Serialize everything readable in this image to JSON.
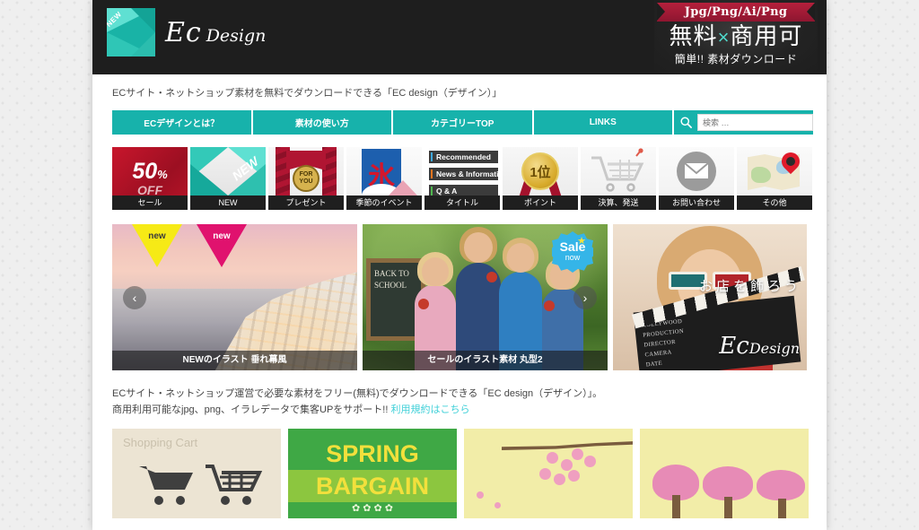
{
  "header": {
    "logo_ribbon": "NEW",
    "logo_text": "Ec",
    "logo_sub": "Design",
    "promo_ribbon": "Jpg/Png/Ai/Png",
    "promo_main_left": "無料",
    "promo_main_x": "×",
    "promo_main_right": "商用可",
    "promo_sub": "簡単!! 素材ダウンロード"
  },
  "tagline": "ECサイト・ネットショップ素材を無料でダウンロードできる「EC design（デザイン）」",
  "nav": {
    "items": [
      {
        "label": "ECデザインとは？"
      },
      {
        "label": "素材の使い方"
      },
      {
        "label": "カテゴリーTOP"
      },
      {
        "label": "LINKS"
      }
    ],
    "search_placeholder": "検索 …",
    "search_value": ""
  },
  "categories": [
    {
      "label": "セール",
      "art": "sale",
      "text_main": "50",
      "text_unit": "%",
      "text_sub": "OFF"
    },
    {
      "label": "NEW",
      "art": "new",
      "text_main": "NEW"
    },
    {
      "label": "プレゼント",
      "art": "gift",
      "text_main": "FOR",
      "text_sub": "YOU"
    },
    {
      "label": "季節のイベント",
      "art": "event",
      "text_main": "氷"
    },
    {
      "label": "タイトル",
      "art": "title",
      "bar1": "Recommended",
      "bar2": "News & Information",
      "bar3": "Q & A"
    },
    {
      "label": "ポイント",
      "art": "point",
      "text_main": "1位"
    },
    {
      "label": "決算、発送",
      "art": "cart"
    },
    {
      "label": "お問い合わせ",
      "art": "mail"
    },
    {
      "label": "その他",
      "art": "map"
    }
  ],
  "slider": {
    "prev_label": "‹",
    "next_label": "›",
    "slides": [
      {
        "caption": "NEWのイラスト 垂れ幕風",
        "tag_a": "new",
        "tag_b": "new"
      },
      {
        "caption": "セールのイラスト素材 丸型2",
        "badge_line1": "Sale",
        "badge_line2": "now",
        "badge_star": "★",
        "board_text": "BACK TO SCHOOL"
      },
      {
        "overlay_jp": "お店を飾ろう",
        "overlay_logo": "Ec",
        "overlay_logo_sub": "Design",
        "clap_lines": "HOLLYWOOD\nPRODUCTION\nDIRECTOR\nCAMERA\nDATE"
      }
    ]
  },
  "description": {
    "line1": "ECサイト・ネットショップ運営で必要な素材をフリー(無料)でダウンロードできる「EC design（デザイン）」。",
    "line2": "商用利用可能なjpg、png、イラレデータで集客UPをサポート!!",
    "link": "利用規約はこちら"
  },
  "thumbs": [
    {
      "art": "cart",
      "title": "Shopping Cart"
    },
    {
      "art": "spring",
      "line1": "SPRING",
      "line2": "BARGAIN"
    },
    {
      "art": "branch",
      "title": ""
    },
    {
      "art": "trees",
      "title": ""
    }
  ],
  "colors": {
    "teal": "#17b2ab",
    "header_dark": "#1e1e1e",
    "ribbon_red": "#b5203c",
    "link": "#3fd0d8",
    "page_bg": "#efefef"
  }
}
